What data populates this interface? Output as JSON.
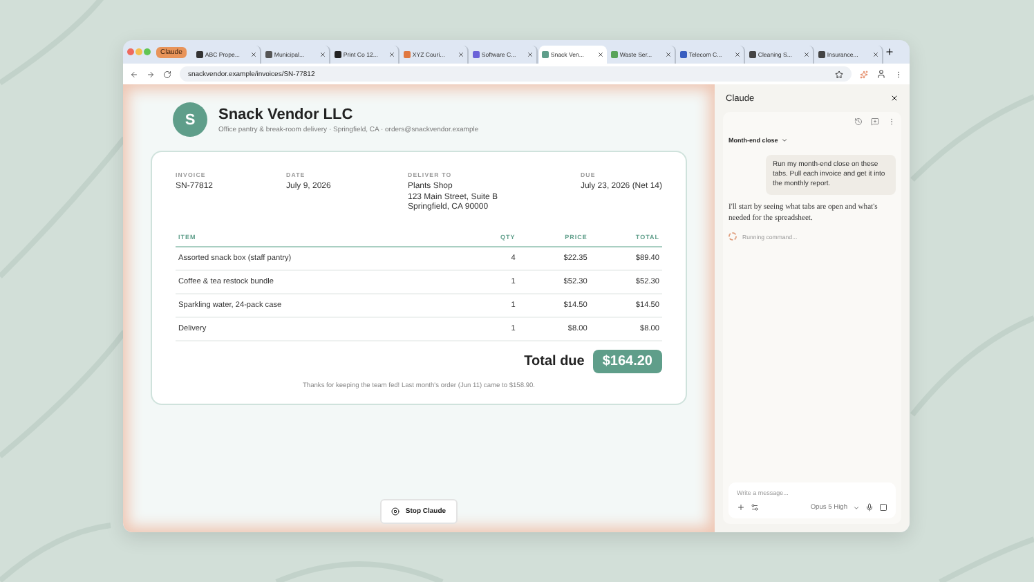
{
  "tab_group": {
    "label": "Claude"
  },
  "tabs": [
    {
      "label": "ABC Prope...",
      "selected": false
    },
    {
      "label": "Municipal...",
      "selected": false
    },
    {
      "label": "Print Co 12...",
      "selected": false
    },
    {
      "label": "XYZ Couri...",
      "selected": false
    },
    {
      "label": "Software C...",
      "selected": false
    },
    {
      "label": "Snack Ven...",
      "selected": true
    },
    {
      "label": "Waste Ser...",
      "selected": false
    },
    {
      "label": "Telecom C...",
      "selected": false
    },
    {
      "label": "Cleaning S...",
      "selected": false
    },
    {
      "label": "Insurance...",
      "selected": false
    }
  ],
  "address": "snackvendor.example/invoices/SN-77812",
  "invoice": {
    "vendor_initial": "S",
    "vendor_name": "Snack Vendor LLC",
    "vendor_tagline": "Office pantry & break-room delivery · Springfield, CA · orders@snackvendor.example",
    "meta": [
      {
        "label": "INVOICE",
        "lines": [
          "SN-77812"
        ]
      },
      {
        "label": "DATE",
        "lines": [
          "July 9, 2026"
        ]
      },
      {
        "label": "DELIVER TO",
        "lines": [
          "Plants Shop",
          "123 Main Street, Suite B",
          "Springfield, CA 90000"
        ]
      },
      {
        "label": "DUE",
        "lines": [
          "July 23, 2026 (Net 14)"
        ]
      }
    ],
    "columns": [
      "ITEM",
      "QTY",
      "PRICE",
      "TOTAL"
    ],
    "rows": [
      [
        "Assorted snack box (staff pantry)",
        "4",
        "$22.35",
        "$89.40"
      ],
      [
        "Coffee & tea restock bundle",
        "1",
        "$52.30",
        "$52.30"
      ],
      [
        "Sparkling water, 24-pack case",
        "1",
        "$14.50",
        "$14.50"
      ],
      [
        "Delivery",
        "1",
        "$8.00",
        "$8.00"
      ]
    ],
    "total_label": "Total due",
    "total_value": "$164.20",
    "note": "Thanks for keeping the team fed! Last month's order (Jun 11) came to $158.90."
  },
  "stop_button": "Stop Claude",
  "panel": {
    "title": "Claude",
    "thread": "Month-end close",
    "user_message": "Run my month-end close on these tabs. Pull each invoice and get it into the monthly report.",
    "assistant_message": "I'll start by seeing what tabs are open and what's needed for the spreadsheet.",
    "status": "Running command...",
    "placeholder": "Write a message...",
    "model": "Opus 5",
    "effort": "High"
  }
}
